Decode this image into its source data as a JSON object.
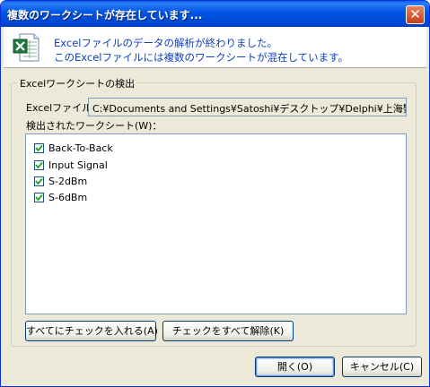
{
  "window": {
    "title": "複数のワークシートが存在しています..."
  },
  "banner": {
    "icon": "excel-file-icon",
    "line1": "Excelファイルのデータの解析が終わりました。",
    "line2": "このExcelファイルには複数のワークシートが混在しています。"
  },
  "group": {
    "title": "Excelワークシートの検出",
    "file_label": "Excelファイル：",
    "file_path": "C:¥Documents and Settings¥Satoshi¥デスクトップ¥Delphi¥上海蟹¥sa",
    "list_label": "検出されたワークシート(W)："
  },
  "worksheets": [
    {
      "name": "Back-To-Back",
      "checked": true
    },
    {
      "name": "Input Signal",
      "checked": true
    },
    {
      "name": "S-2dBm",
      "checked": true
    },
    {
      "name": "S-6dBm",
      "checked": true
    }
  ],
  "buttons": {
    "check_all": "すべてにチェックを入れる(A)",
    "uncheck_all": "チェックをすべて解除(K)",
    "open": "開く(O)",
    "cancel": "キャンセル(C)"
  },
  "colors": {
    "titlebar": "#0054e3",
    "banner_text": "#1040c0",
    "dialog_bg": "#ece9d8"
  }
}
